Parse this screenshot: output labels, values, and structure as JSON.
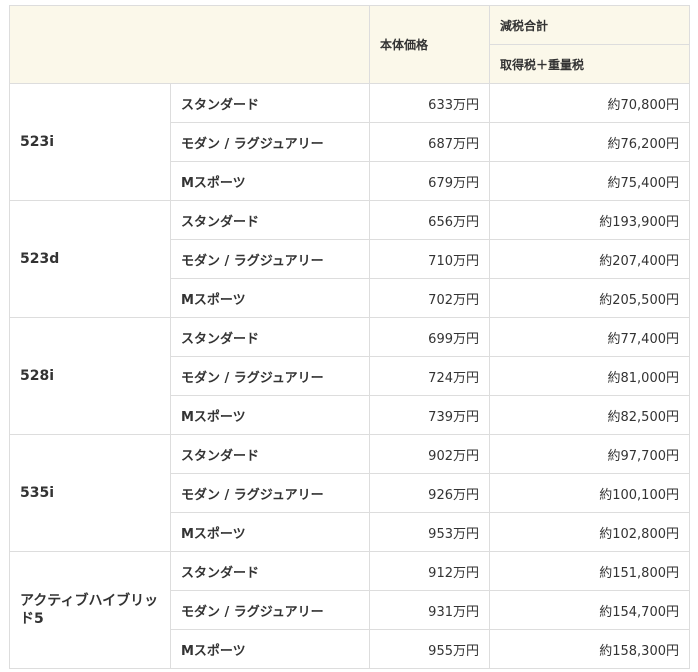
{
  "header": {
    "price_label": "本体価格",
    "tax_label": "減税合計",
    "tax_sub_label": "取得税＋重量税"
  },
  "groups": [
    {
      "model": "523i",
      "rows": [
        {
          "grade": "スタンダード",
          "price": "633万円",
          "tax": "約70,800円"
        },
        {
          "grade": "モダン / ラグジュアリー",
          "price": "687万円",
          "tax": "約76,200円"
        },
        {
          "grade": "Mスポーツ",
          "price": "679万円",
          "tax": "約75,400円"
        }
      ]
    },
    {
      "model": "523d",
      "rows": [
        {
          "grade": "スタンダード",
          "price": "656万円",
          "tax": "約193,900円"
        },
        {
          "grade": "モダン / ラグジュアリー",
          "price": "710万円",
          "tax": "約207,400円"
        },
        {
          "grade": "Mスポーツ",
          "price": "702万円",
          "tax": "約205,500円"
        }
      ]
    },
    {
      "model": "528i",
      "rows": [
        {
          "grade": "スタンダード",
          "price": "699万円",
          "tax": "約77,400円"
        },
        {
          "grade": "モダン / ラグジュアリー",
          "price": "724万円",
          "tax": "約81,000円"
        },
        {
          "grade": "Mスポーツ",
          "price": "739万円",
          "tax": "約82,500円"
        }
      ]
    },
    {
      "model": "535i",
      "rows": [
        {
          "grade": "スタンダード",
          "price": "902万円",
          "tax": "約97,700円"
        },
        {
          "grade": "モダン / ラグジュアリー",
          "price": "926万円",
          "tax": "約100,100円"
        },
        {
          "grade": "Mスポーツ",
          "price": "953万円",
          "tax": "約102,800円"
        }
      ]
    },
    {
      "model": "アクティブハイブリッド5",
      "rows": [
        {
          "grade": "スタンダード",
          "price": "912万円",
          "tax": "約151,800円"
        },
        {
          "grade": "モダン / ラグジュアリー",
          "price": "931万円",
          "tax": "約154,700円"
        },
        {
          "grade": "Mスポーツ",
          "price": "955万円",
          "tax": "約158,300円"
        }
      ]
    }
  ],
  "colors": {
    "header_background": "#fbf8ea",
    "border": "#dddddd",
    "text": "#333333"
  }
}
